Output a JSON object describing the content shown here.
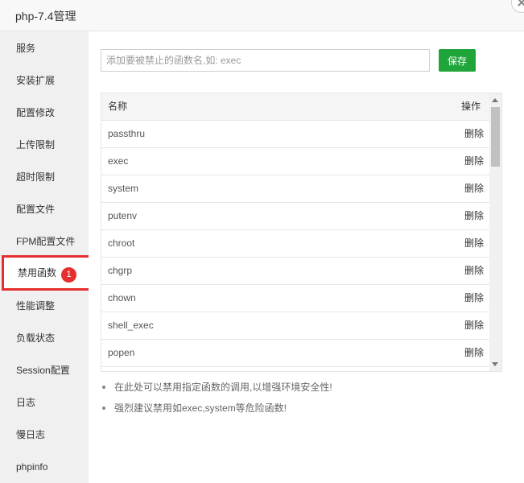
{
  "window": {
    "title": "php-7.4管理"
  },
  "sidebar": {
    "items": [
      {
        "label": "服务"
      },
      {
        "label": "安装扩展"
      },
      {
        "label": "配置修改"
      },
      {
        "label": "上传限制"
      },
      {
        "label": "超时限制"
      },
      {
        "label": "配置文件"
      },
      {
        "label": "FPM配置文件"
      },
      {
        "label": "禁用函数",
        "active": true,
        "badge": "1"
      },
      {
        "label": "性能调整"
      },
      {
        "label": "负载状态"
      },
      {
        "label": "Session配置"
      },
      {
        "label": "日志"
      },
      {
        "label": "慢日志"
      },
      {
        "label": "phpinfo"
      }
    ]
  },
  "form": {
    "placeholder": "添加要被禁止的函数名,如: exec",
    "value": "",
    "save_label": "保存"
  },
  "table": {
    "headers": {
      "name": "名称",
      "action": "操作"
    },
    "rows": [
      {
        "name": "passthru",
        "action": "删除"
      },
      {
        "name": "exec",
        "action": "删除"
      },
      {
        "name": "system",
        "action": "删除"
      },
      {
        "name": "putenv",
        "action": "删除"
      },
      {
        "name": "chroot",
        "action": "删除"
      },
      {
        "name": "chgrp",
        "action": "删除"
      },
      {
        "name": "chown",
        "action": "删除"
      },
      {
        "name": "shell_exec",
        "action": "删除"
      },
      {
        "name": "popen",
        "action": "删除"
      },
      {
        "name": "",
        "action": ""
      }
    ]
  },
  "tips": [
    "在此处可以禁用指定函数的调用,以增强环境安全性!",
    "强烈建议禁用如exec,system等危险函数!"
  ],
  "colors": {
    "accent": "#20a53a",
    "highlight": "#e62e2e"
  }
}
